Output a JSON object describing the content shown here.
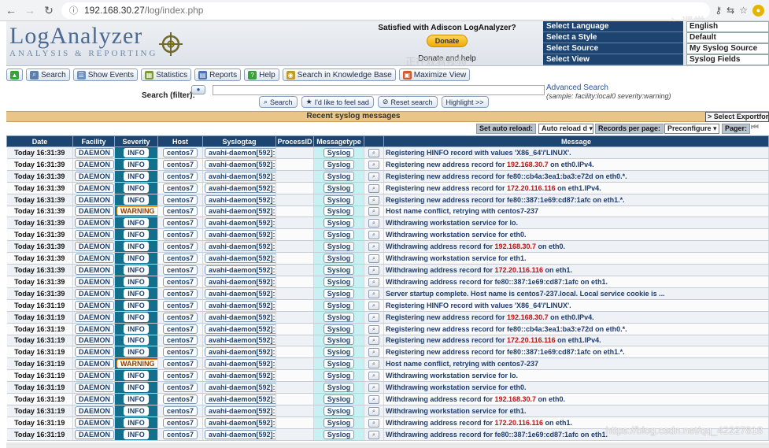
{
  "browser": {
    "url_host": "192.168.30.27",
    "url_path": "/log/index.php"
  },
  "header": {
    "logo_title": "LogAnalyzer",
    "logo_subtitle": "ANALYSIS & REPORTING",
    "donate_text": "Satisfied with Adiscon LogAnalyzer?",
    "donate_button": "Donate",
    "donate_help": "Donate and help",
    "settings": [
      {
        "label": "Select Language",
        "value": "English"
      },
      {
        "label": "Select a Style",
        "value": "Default"
      },
      {
        "label": "Select Source",
        "value": "My Syslog Source"
      },
      {
        "label": "Select View",
        "value": "Syslog Fields"
      }
    ]
  },
  "toolbar": {
    "buttons": [
      {
        "label": "",
        "icon": "green-up-icon"
      },
      {
        "label": "Search",
        "icon": "search-icon"
      },
      {
        "label": "Show Events",
        "icon": "events-icon"
      },
      {
        "label": "Statistics",
        "icon": "chart-icon"
      },
      {
        "label": "Reports",
        "icon": "reports-icon"
      },
      {
        "label": "Help",
        "icon": "help-icon"
      },
      {
        "label": "Search in Knowledge Base",
        "icon": "kb-icon"
      },
      {
        "label": "Maximize View",
        "icon": "maximize-icon"
      }
    ]
  },
  "search": {
    "label": "Search (filter):",
    "input_value": "",
    "advanced_link": "Advanced Search",
    "sample": "(sample: facility:local0 severity:warning)",
    "buttons": [
      "Search",
      "I'd like to feel sad",
      "Reset search",
      "Highlight >>"
    ]
  },
  "recent": {
    "title": "Recent syslog messages",
    "export": "> Select Exportform"
  },
  "pager": {
    "auto_reload_label": "Set auto reload:",
    "auto_reload_value": "Auto reload d",
    "records_label": "Records per page:",
    "records_value": "Preconfigure",
    "pager_label": "Pager:"
  },
  "table": {
    "columns": [
      "Date",
      "Facility",
      "Severity",
      "Host",
      "Syslogtag",
      "ProcessID",
      "Messagetype",
      "",
      "Message"
    ],
    "rows": [
      {
        "date": "Today 16:31:39",
        "facility": "DAEMON",
        "severity": "INFO",
        "host": "centos7",
        "tag": "avahi-daemon[592]:",
        "pid": "",
        "type": "Syslog",
        "msg": "Registering HINFO record with values 'X86_64'/'LINUX'.",
        "ip": "",
        "msg2": ""
      },
      {
        "date": "Today 16:31:39",
        "facility": "DAEMON",
        "severity": "INFO",
        "host": "centos7",
        "tag": "avahi-daemon[592]:",
        "pid": "",
        "type": "Syslog",
        "msg": "Registering new address record for ",
        "ip": "192.168.30.7",
        "msg2": " on eth0.IPv4."
      },
      {
        "date": "Today 16:31:39",
        "facility": "DAEMON",
        "severity": "INFO",
        "host": "centos7",
        "tag": "avahi-daemon[592]:",
        "pid": "",
        "type": "Syslog",
        "msg": "Registering new address record for fe80::cb4a:3ea1:ba3:e72d on eth0.*.",
        "ip": "",
        "msg2": ""
      },
      {
        "date": "Today 16:31:39",
        "facility": "DAEMON",
        "severity": "INFO",
        "host": "centos7",
        "tag": "avahi-daemon[592]:",
        "pid": "",
        "type": "Syslog",
        "msg": "Registering new address record for ",
        "ip": "172.20.116.116",
        "msg2": " on eth1.IPv4."
      },
      {
        "date": "Today 16:31:39",
        "facility": "DAEMON",
        "severity": "INFO",
        "host": "centos7",
        "tag": "avahi-daemon[592]:",
        "pid": "",
        "type": "Syslog",
        "msg": "Registering new address record for fe80::387:1e69:cd87:1afc on eth1.*.",
        "ip": "",
        "msg2": ""
      },
      {
        "date": "Today 16:31:39",
        "facility": "DAEMON",
        "severity": "WARNING",
        "host": "centos7",
        "tag": "avahi-daemon[592]:",
        "pid": "",
        "type": "Syslog",
        "msg": "Host name conflict, retrying with centos7-237",
        "ip": "",
        "msg2": ""
      },
      {
        "date": "Today 16:31:39",
        "facility": "DAEMON",
        "severity": "INFO",
        "host": "centos7",
        "tag": "avahi-daemon[592]:",
        "pid": "",
        "type": "Syslog",
        "msg": "Withdrawing workstation service for lo.",
        "ip": "",
        "msg2": ""
      },
      {
        "date": "Today 16:31:39",
        "facility": "DAEMON",
        "severity": "INFO",
        "host": "centos7",
        "tag": "avahi-daemon[592]:",
        "pid": "",
        "type": "Syslog",
        "msg": "Withdrawing workstation service for eth0.",
        "ip": "",
        "msg2": ""
      },
      {
        "date": "Today 16:31:39",
        "facility": "DAEMON",
        "severity": "INFO",
        "host": "centos7",
        "tag": "avahi-daemon[592]:",
        "pid": "",
        "type": "Syslog",
        "msg": "Withdrawing address record for ",
        "ip": "192.168.30.7",
        "msg2": " on eth0."
      },
      {
        "date": "Today 16:31:39",
        "facility": "DAEMON",
        "severity": "INFO",
        "host": "centos7",
        "tag": "avahi-daemon[592]:",
        "pid": "",
        "type": "Syslog",
        "msg": "Withdrawing workstation service for eth1.",
        "ip": "",
        "msg2": ""
      },
      {
        "date": "Today 16:31:39",
        "facility": "DAEMON",
        "severity": "INFO",
        "host": "centos7",
        "tag": "avahi-daemon[592]:",
        "pid": "",
        "type": "Syslog",
        "msg": "Withdrawing address record for ",
        "ip": "172.20.116.116",
        "msg2": " on eth1."
      },
      {
        "date": "Today 16:31:39",
        "facility": "DAEMON",
        "severity": "INFO",
        "host": "centos7",
        "tag": "avahi-daemon[592]:",
        "pid": "",
        "type": "Syslog",
        "msg": "Withdrawing address record for fe80::387:1e69:cd87:1afc on eth1.",
        "ip": "",
        "msg2": ""
      },
      {
        "date": "Today 16:31:39",
        "facility": "DAEMON",
        "severity": "INFO",
        "host": "centos7",
        "tag": "avahi-daemon[592]:",
        "pid": "",
        "type": "Syslog",
        "msg": "Server startup complete. Host name is centos7-237.local. Local service cookie is ...",
        "ip": "",
        "msg2": ""
      },
      {
        "date": "Today 16:31:19",
        "facility": "DAEMON",
        "severity": "INFO",
        "host": "centos7",
        "tag": "avahi-daemon[592]:",
        "pid": "",
        "type": "Syslog",
        "msg": "Registering HINFO record with values 'X86_64'/'LINUX'.",
        "ip": "",
        "msg2": ""
      },
      {
        "date": "Today 16:31:19",
        "facility": "DAEMON",
        "severity": "INFO",
        "host": "centos7",
        "tag": "avahi-daemon[592]:",
        "pid": "",
        "type": "Syslog",
        "msg": "Registering new address record for ",
        "ip": "192.168.30.7",
        "msg2": " on eth0.IPv4."
      },
      {
        "date": "Today 16:31:19",
        "facility": "DAEMON",
        "severity": "INFO",
        "host": "centos7",
        "tag": "avahi-daemon[592]:",
        "pid": "",
        "type": "Syslog",
        "msg": "Registering new address record for fe80::cb4a:3ea1:ba3:e72d on eth0.*.",
        "ip": "",
        "msg2": ""
      },
      {
        "date": "Today 16:31:19",
        "facility": "DAEMON",
        "severity": "INFO",
        "host": "centos7",
        "tag": "avahi-daemon[592]:",
        "pid": "",
        "type": "Syslog",
        "msg": "Registering new address record for ",
        "ip": "172.20.116.116",
        "msg2": " on eth1.IPv4."
      },
      {
        "date": "Today 16:31:19",
        "facility": "DAEMON",
        "severity": "INFO",
        "host": "centos7",
        "tag": "avahi-daemon[592]:",
        "pid": "",
        "type": "Syslog",
        "msg": "Registering new address record for fe80::387:1e69:cd87:1afc on eth1.*.",
        "ip": "",
        "msg2": ""
      },
      {
        "date": "Today 16:31:19",
        "facility": "DAEMON",
        "severity": "WARNING",
        "host": "centos7",
        "tag": "avahi-daemon[592]:",
        "pid": "",
        "type": "Syslog",
        "msg": "Host name conflict, retrying with centos7-237",
        "ip": "",
        "msg2": ""
      },
      {
        "date": "Today 16:31:19",
        "facility": "DAEMON",
        "severity": "INFO",
        "host": "centos7",
        "tag": "avahi-daemon[592]:",
        "pid": "",
        "type": "Syslog",
        "msg": "Withdrawing workstation service for lo.",
        "ip": "",
        "msg2": ""
      },
      {
        "date": "Today 16:31:19",
        "facility": "DAEMON",
        "severity": "INFO",
        "host": "centos7",
        "tag": "avahi-daemon[592]:",
        "pid": "",
        "type": "Syslog",
        "msg": "Withdrawing workstation service for eth0.",
        "ip": "",
        "msg2": ""
      },
      {
        "date": "Today 16:31:19",
        "facility": "DAEMON",
        "severity": "INFO",
        "host": "centos7",
        "tag": "avahi-daemon[592]:",
        "pid": "",
        "type": "Syslog",
        "msg": "Withdrawing address record for ",
        "ip": "192.168.30.7",
        "msg2": " on eth0."
      },
      {
        "date": "Today 16:31:19",
        "facility": "DAEMON",
        "severity": "INFO",
        "host": "centos7",
        "tag": "avahi-daemon[592]:",
        "pid": "",
        "type": "Syslog",
        "msg": "Withdrawing workstation service for eth1.",
        "ip": "",
        "msg2": ""
      },
      {
        "date": "Today 16:31:19",
        "facility": "DAEMON",
        "severity": "INFO",
        "host": "centos7",
        "tag": "avahi-daemon[592]:",
        "pid": "",
        "type": "Syslog",
        "msg": "Withdrawing address record for ",
        "ip": "172.20.116.116",
        "msg2": " on eth1."
      },
      {
        "date": "Today 16:31:19",
        "facility": "DAEMON",
        "severity": "INFO",
        "host": "centos7",
        "tag": "avahi-daemon[592]:",
        "pid": "",
        "type": "Syslog",
        "msg": "Withdrawing address record for fe80::387:1e69:cd87:1afc on eth1.",
        "ip": "",
        "msg2": ""
      }
    ]
  },
  "overlay_text": "正在观看视频",
  "watermark": "https://blog.csdn.net/qq_42227818"
}
